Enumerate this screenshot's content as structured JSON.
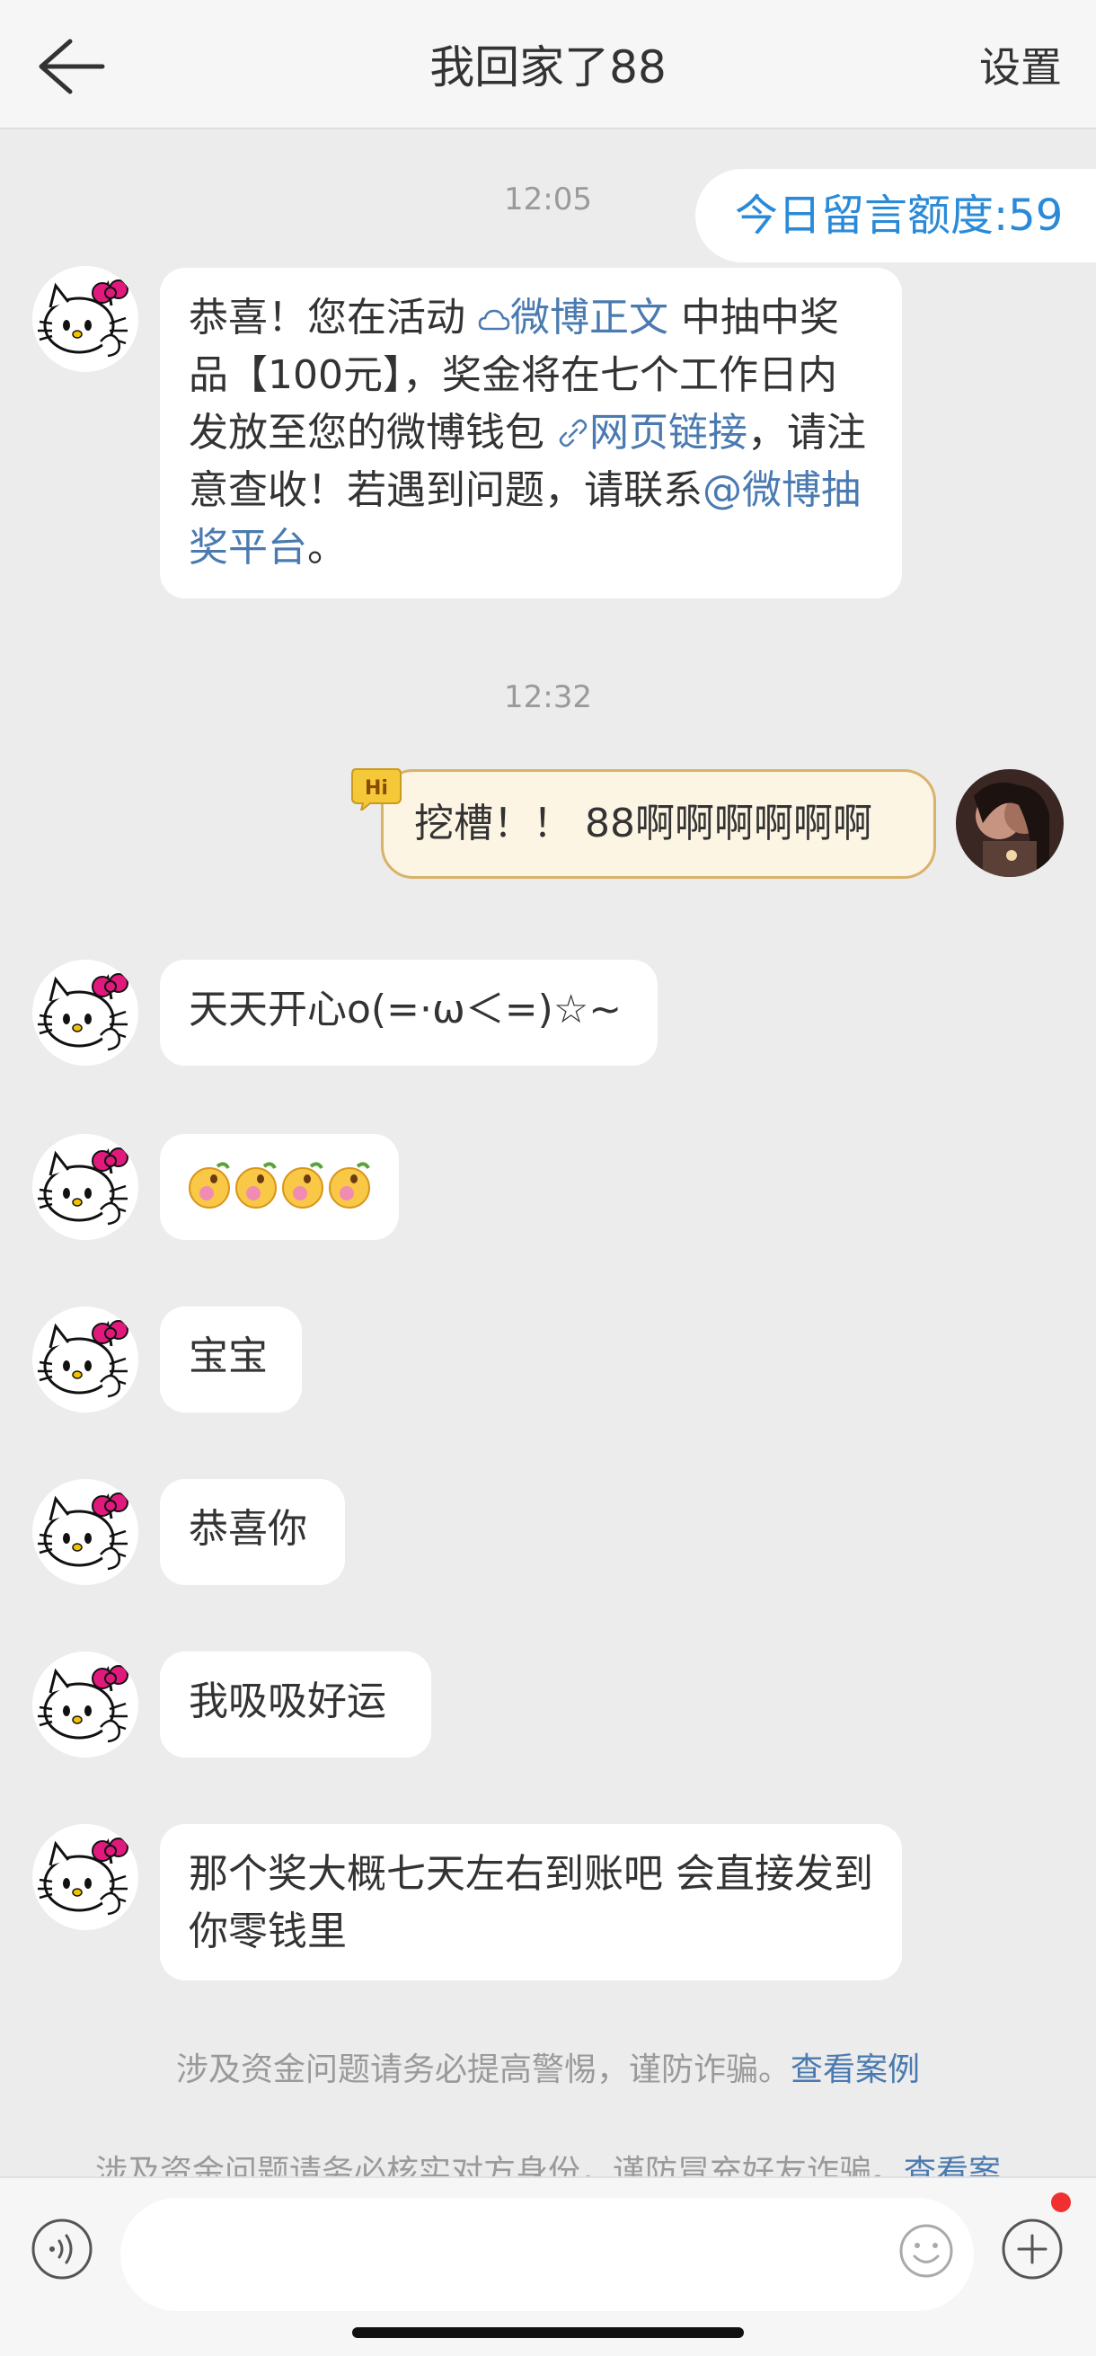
{
  "header": {
    "title": "我回家了88",
    "settings_label": "设置"
  },
  "quota": "今日留言额度:59",
  "timestamps": [
    "12:05",
    "12:32"
  ],
  "messages": [
    {
      "from": "other",
      "parts": {
        "p1": "恭喜！您在活动 ",
        "link1": "微博正文",
        "p2": " 中抽中奖品【100元】，奖金将在七个工作日内发放至您的微博钱包 ",
        "link2": "网页链接",
        "p3": "，请注意查收！若遇到问题，请联系",
        "mention": "@微博抽奖平台",
        "p4": "。"
      }
    },
    {
      "from": "me",
      "text": "挖槽！！ 88啊啊啊啊啊啊"
    },
    {
      "from": "other",
      "text": "天天开心o(=·ω＜=)☆~"
    },
    {
      "from": "other",
      "text": "emoji-stickers"
    },
    {
      "from": "other",
      "text": "宝宝"
    },
    {
      "from": "other",
      "text": "恭喜你"
    },
    {
      "from": "other",
      "text": "我吸吸好运"
    },
    {
      "from": "other",
      "text": "那个奖大概七天左右到账吧 会直接发到你零钱里"
    }
  ],
  "hi_badge": "Hi",
  "notices": [
    {
      "text": "涉及资金问题请务必提高警惕，谨防诈骗。",
      "link": "查看案例"
    },
    {
      "text": "涉及资金问题请务必核实对方身份，谨防冒充好友诈骗。",
      "link": "查看案"
    }
  ],
  "colors": {
    "link": "#4a7ab0",
    "quota": "#2a8ad8",
    "background": "#ececec",
    "my_bubble": "#fdf5e4",
    "my_bubble_border": "#d9b26a"
  }
}
